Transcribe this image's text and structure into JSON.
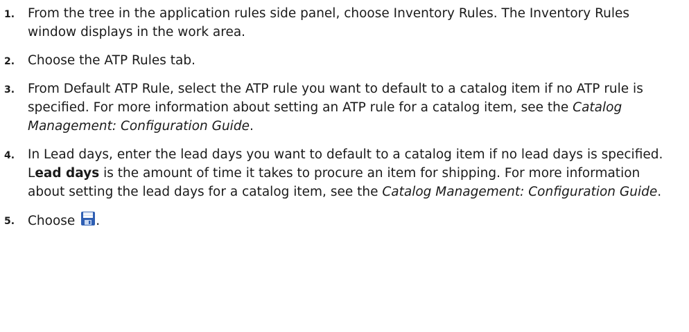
{
  "steps": [
    {
      "number": "1.",
      "text": "From the tree in the application rules side panel, choose Inventory Rules. The Inventory Rules window displays in the work area."
    },
    {
      "number": "2.",
      "text": "Choose the ATP Rules tab."
    },
    {
      "number": "3.",
      "text_before": "From Default ATP Rule, select the ATP rule you want to default to a catalog item if no ATP rule is specified. For more information about setting an ATP rule for a catalog item, see the ",
      "guide_title": "Catalog Management: Configuration Guide",
      "text_after": "."
    },
    {
      "number": "4.",
      "text_before": "In Lead days, enter the lead days you want to default to a catalog item if no lead days is specified. L",
      "bold_term": "ead days",
      "text_middle": " is the amount of time it takes to procure an item for shipping. For more information about setting the lead days for a catalog item, see the ",
      "guide_title": "Catalog Management: Configuration Guide",
      "text_after": "."
    },
    {
      "number": "5.",
      "text_before": "Choose ",
      "icon": "save-icon",
      "text_after": "."
    }
  ],
  "colors": {
    "text": "#1a1a1a",
    "icon_blue": "#2f5fb3",
    "icon_light": "#c9d9f2"
  }
}
